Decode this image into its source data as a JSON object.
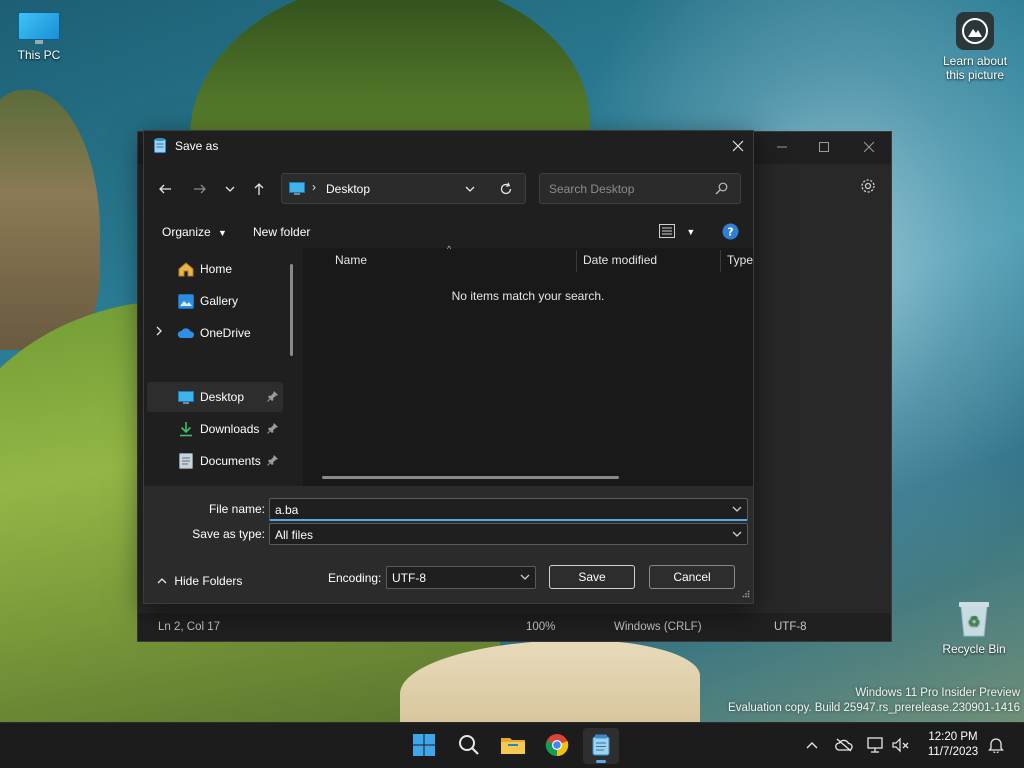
{
  "desktop": {
    "icons": {
      "this_pc": "This PC",
      "learn_line1": "Learn about",
      "learn_line2": "this picture",
      "recycle_bin": "Recycle Bin"
    },
    "watermark": {
      "line1": "Windows 11 Pro Insider Preview",
      "line2": "Evaluation copy. Build 25947.rs_prerelease.230901-1416"
    }
  },
  "notepad": {
    "status": {
      "position": "Ln 2, Col 17",
      "zoom": "100%",
      "line_ending": "Windows (CRLF)",
      "encoding": "UTF-8"
    }
  },
  "dialog": {
    "title": "Save as",
    "address": {
      "current": "Desktop"
    },
    "search": {
      "placeholder": "Search Desktop"
    },
    "commands": {
      "organize": "Organize",
      "new_folder": "New folder"
    },
    "nav": {
      "items": [
        {
          "label": "Home",
          "icon": "home-icon"
        },
        {
          "label": "Gallery",
          "icon": "gallery-icon"
        },
        {
          "label": "OneDrive",
          "icon": "cloud-icon"
        },
        {
          "label": "Desktop",
          "icon": "desktop-icon",
          "selected": true
        },
        {
          "label": "Downloads",
          "icon": "download-icon"
        },
        {
          "label": "Documents",
          "icon": "document-icon"
        }
      ]
    },
    "columns": [
      "Name",
      "Date modified",
      "Type"
    ],
    "empty_message": "No items match your search.",
    "file_name_label": "File name:",
    "file_name_value": "a.ba",
    "save_type_label": "Save as type:",
    "save_type_value": "All files",
    "hide_folders": "Hide Folders",
    "encoding_label": "Encoding:",
    "encoding_value": "UTF-8",
    "save_button": "Save",
    "cancel_button": "Cancel"
  },
  "taskbar": {
    "clock_time": "12:20 PM",
    "clock_date": "11/7/2023"
  },
  "colors": {
    "accent": "#5aa9e6",
    "dialog_bg": "#1f1f1f",
    "taskbar_bg": "#1c1c1c"
  }
}
